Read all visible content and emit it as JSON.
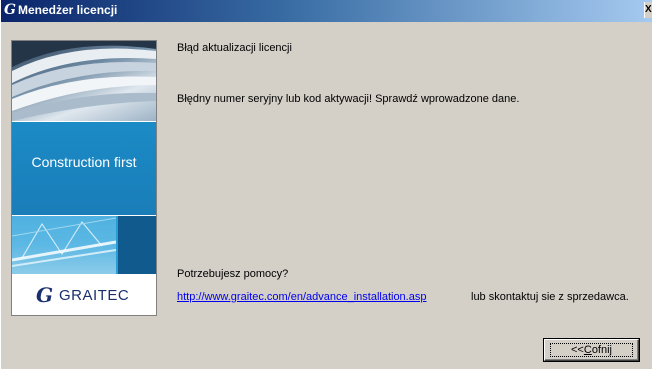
{
  "window": {
    "title": "Menedżer licencji",
    "title_logo": "G",
    "close_glyph": "X",
    "colors": {
      "title_start": "#0a246a",
      "title_end": "#a6caf0",
      "face": "#d4d0c8",
      "link": "#0000ee"
    }
  },
  "banner": {
    "slogan": "Construction first",
    "brand_mark": "G",
    "brand_name": "GRAITEC",
    "colors": {
      "slogan_panel": "#1b8bc6",
      "strip_square": "#115a8e",
      "brand": "#1a2f6e"
    }
  },
  "content": {
    "heading": "Błąd aktualizacji licencji",
    "message": "Błędny numer seryjny lub kod aktywacji! Sprawdź wprowadzone dane.",
    "help_question": "Potrzebujesz pomocy?",
    "help_link": "http://www.graitec.com/en/advance_installation.asp",
    "help_alternative": "lub skontaktuj sie z sprzedawca."
  },
  "buttons": {
    "back_prefix": "<<",
    "back_accesskey": "C",
    "back_rest": "ofnij"
  }
}
